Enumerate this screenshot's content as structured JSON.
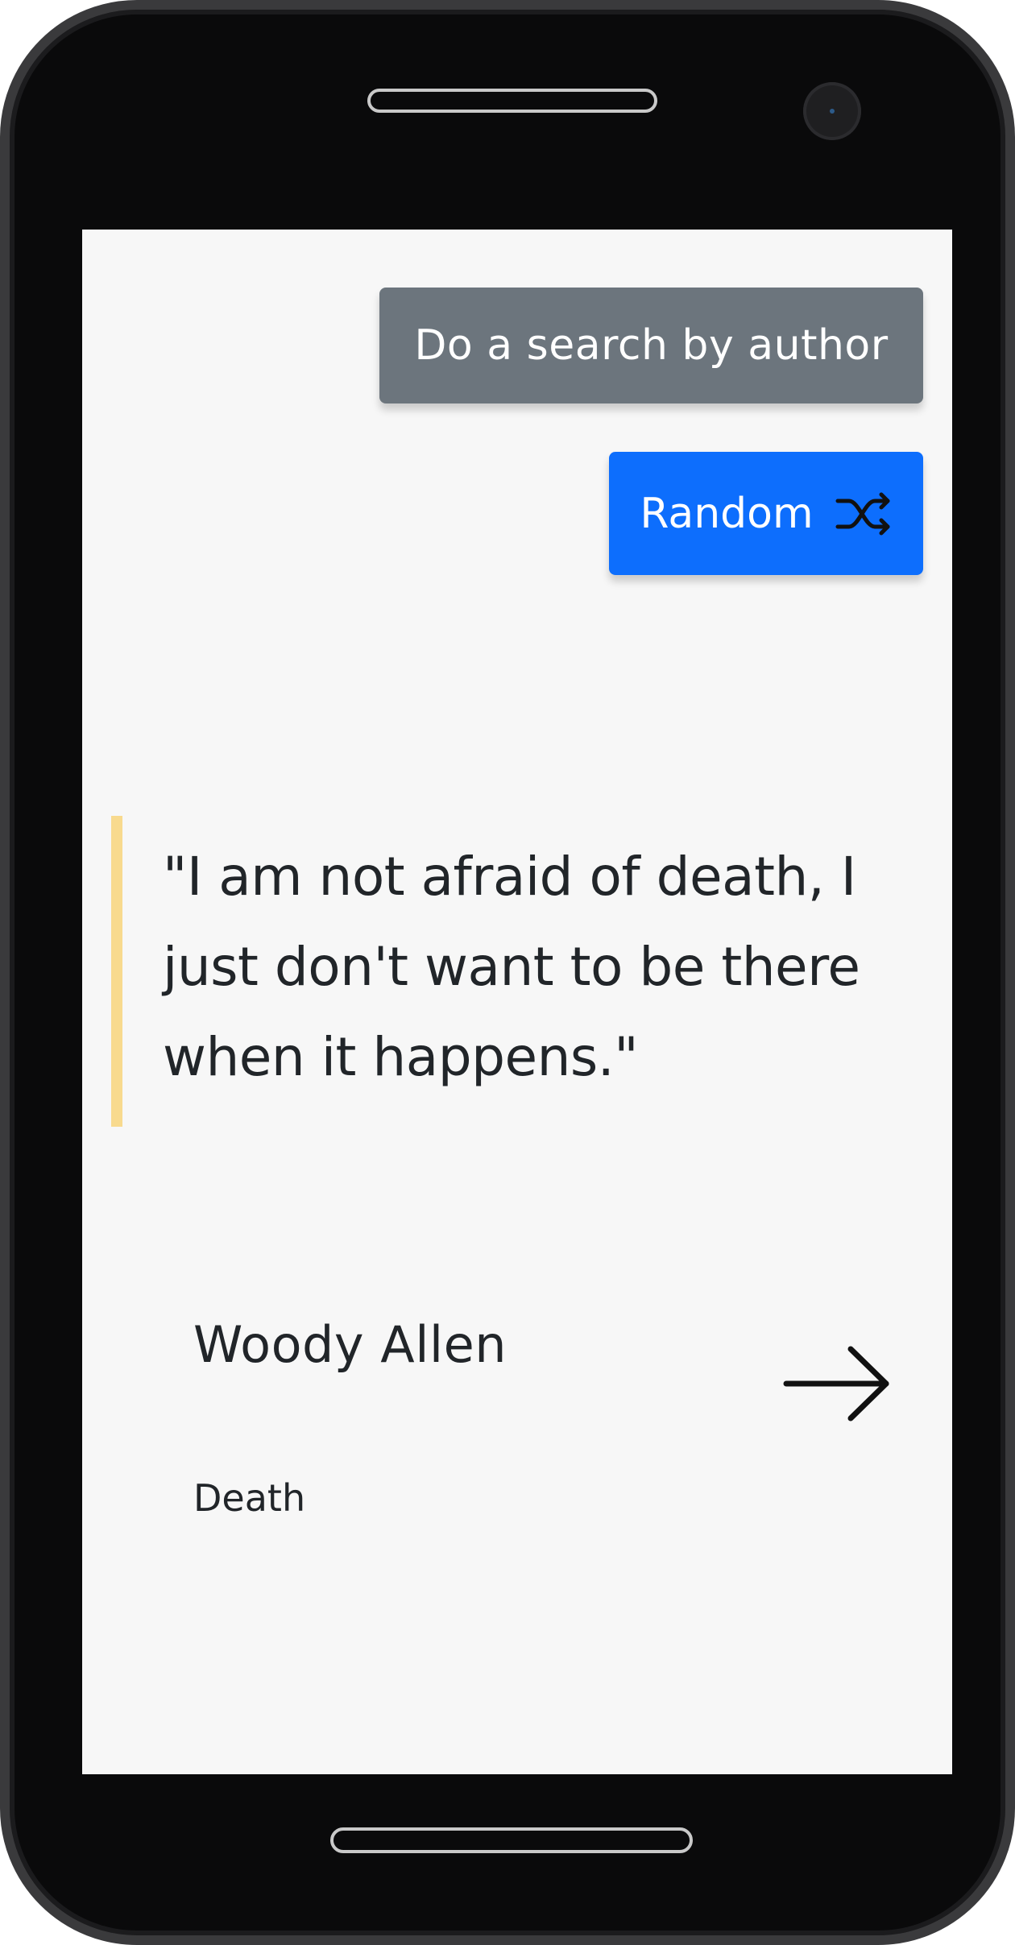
{
  "toolbar": {
    "search_by_author_label": "Do a search by author",
    "random_label": "Random"
  },
  "quote": {
    "text": "\"I am not afraid of death, I just don't want to be there when it happens.\"",
    "author": "Woody Allen",
    "tag": "Death"
  },
  "icons": {
    "shuffle": "shuffle-icon",
    "arrow": "arrow-right-icon"
  },
  "colors": {
    "search_button": "#6c757d",
    "random_button": "#0d6efd",
    "quote_border": "#f8da8e",
    "screen_background": "#f7f7f7"
  }
}
